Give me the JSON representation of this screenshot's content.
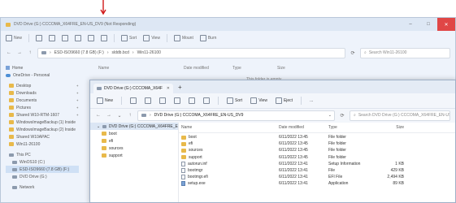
{
  "colors": {
    "accent": "#e04646",
    "folder": "#e8b94a",
    "selection": "#cfe0f5"
  },
  "back_window": {
    "title": "DVD Drive (G:) CCCOMA_X64FRE_EN-US_DV9 (Not Responding)",
    "commands": [
      {
        "icon": "new-icon",
        "label": "New"
      },
      {
        "icon": "cut-icon",
        "label": ""
      },
      {
        "icon": "copy-icon",
        "label": ""
      },
      {
        "icon": "paste-icon",
        "label": ""
      },
      {
        "icon": "rename-icon",
        "label": ""
      },
      {
        "icon": "share-icon",
        "label": ""
      },
      {
        "icon": "delete-icon",
        "label": ""
      },
      {
        "icon": "sort-icon",
        "label": "Sort"
      },
      {
        "icon": "view-icon",
        "label": "View"
      },
      {
        "icon": "mount-icon",
        "label": "Mount"
      },
      {
        "icon": "burn-icon",
        "label": "Burn"
      }
    ],
    "address_path": [
      "ESD-ISO9660 (7.8 GB) (F:)",
      "slddb.bcd",
      "Win11-26100"
    ],
    "search_placeholder": "Search Win11-26100",
    "columns": [
      "Name",
      "Date modified",
      "Type",
      "Size"
    ],
    "empty_text": "This folder is empty.",
    "sidebar": [
      {
        "icon": "home-icon",
        "label": "Home"
      },
      {
        "icon": "onedrive-icon",
        "label": "OneDrive - Personal"
      },
      {
        "icon": "folder-icon",
        "label": "Desktop",
        "pinned": true
      },
      {
        "icon": "folder-icon",
        "label": "Downloads",
        "pinned": true
      },
      {
        "icon": "folder-icon",
        "label": "Documents",
        "pinned": true
      },
      {
        "icon": "folder-icon",
        "label": "Pictures",
        "pinned": true
      },
      {
        "icon": "folder-icon",
        "label": "Shared W10-RTM-1607",
        "pinned": true
      },
      {
        "icon": "folder-icon",
        "label": "WindowsImageBackup (1) Inside"
      },
      {
        "icon": "folder-icon",
        "label": "WindowsImageBackup (2) Inside"
      },
      {
        "icon": "folder-icon",
        "label": "Shared W10APAC"
      },
      {
        "icon": "folder-icon",
        "label": "Win11-26100"
      },
      {
        "icon": "pc-icon",
        "label": "This PC"
      },
      {
        "icon": "drive-icon",
        "label": "WinOS10 (C:)"
      },
      {
        "icon": "drive-icon",
        "label": "ESD-ISO9660 (7.8 GB) (F:)",
        "selected": true
      },
      {
        "icon": "drive-icon",
        "label": "DVD Drive (G:)"
      },
      {
        "icon": "network-icon",
        "label": "Network"
      }
    ]
  },
  "front_window": {
    "tab_title": "DVD Drive (G:) CCCOMA_X64F",
    "commands": [
      {
        "icon": "new-icon",
        "label": "New"
      },
      {
        "icon": "cut-icon",
        "label": ""
      },
      {
        "icon": "copy-icon",
        "label": ""
      },
      {
        "icon": "paste-icon",
        "label": ""
      },
      {
        "icon": "rename-icon",
        "label": ""
      },
      {
        "icon": "share-icon",
        "label": ""
      },
      {
        "icon": "delete-icon",
        "label": ""
      },
      {
        "icon": "sort-icon",
        "label": "Sort"
      },
      {
        "icon": "view-icon",
        "label": "View"
      },
      {
        "icon": "eject-icon",
        "label": "Eject"
      },
      {
        "icon": "more-icon",
        "label": "..."
      }
    ],
    "address": "DVD Drive (G:) CCCOMA_X64FRE_EN-US_DV9",
    "search_placeholder": "Search DVD Drive (G:) CCCOMA_X64FRE_EN-US_DV9",
    "sidebar_root": "DVD Drive (G:) CCCOMA_X64FRE_EN-US_DV9",
    "sidebar_children": [
      "boot",
      "efi",
      "sources",
      "support"
    ],
    "columns": [
      "Name",
      "Date modified",
      "Type",
      "Size"
    ],
    "files": [
      {
        "name": "boot",
        "date": "6/11/2022 13:45",
        "type": "File folder",
        "size": "",
        "icon": "folder"
      },
      {
        "name": "efi",
        "date": "6/11/2022 13:45",
        "type": "File folder",
        "size": "",
        "icon": "folder"
      },
      {
        "name": "sources",
        "date": "6/11/2022 13:45",
        "type": "File folder",
        "size": "",
        "icon": "folder"
      },
      {
        "name": "support",
        "date": "6/11/2022 13:45",
        "type": "File folder",
        "size": "",
        "icon": "folder"
      },
      {
        "name": "autorun.inf",
        "date": "6/11/2022 13:41",
        "type": "Setup Information",
        "size": "1 KB",
        "icon": "file"
      },
      {
        "name": "bootmgr",
        "date": "6/11/2022 13:41",
        "type": "File",
        "size": "429 KB",
        "icon": "file"
      },
      {
        "name": "bootmgr.efi",
        "date": "6/11/2022 13:41",
        "type": "EFI File",
        "size": "2,494 KB",
        "icon": "file"
      },
      {
        "name": "setup.exe",
        "date": "6/11/2022 13:41",
        "type": "Application",
        "size": "89 KB",
        "icon": "exe"
      }
    ]
  }
}
